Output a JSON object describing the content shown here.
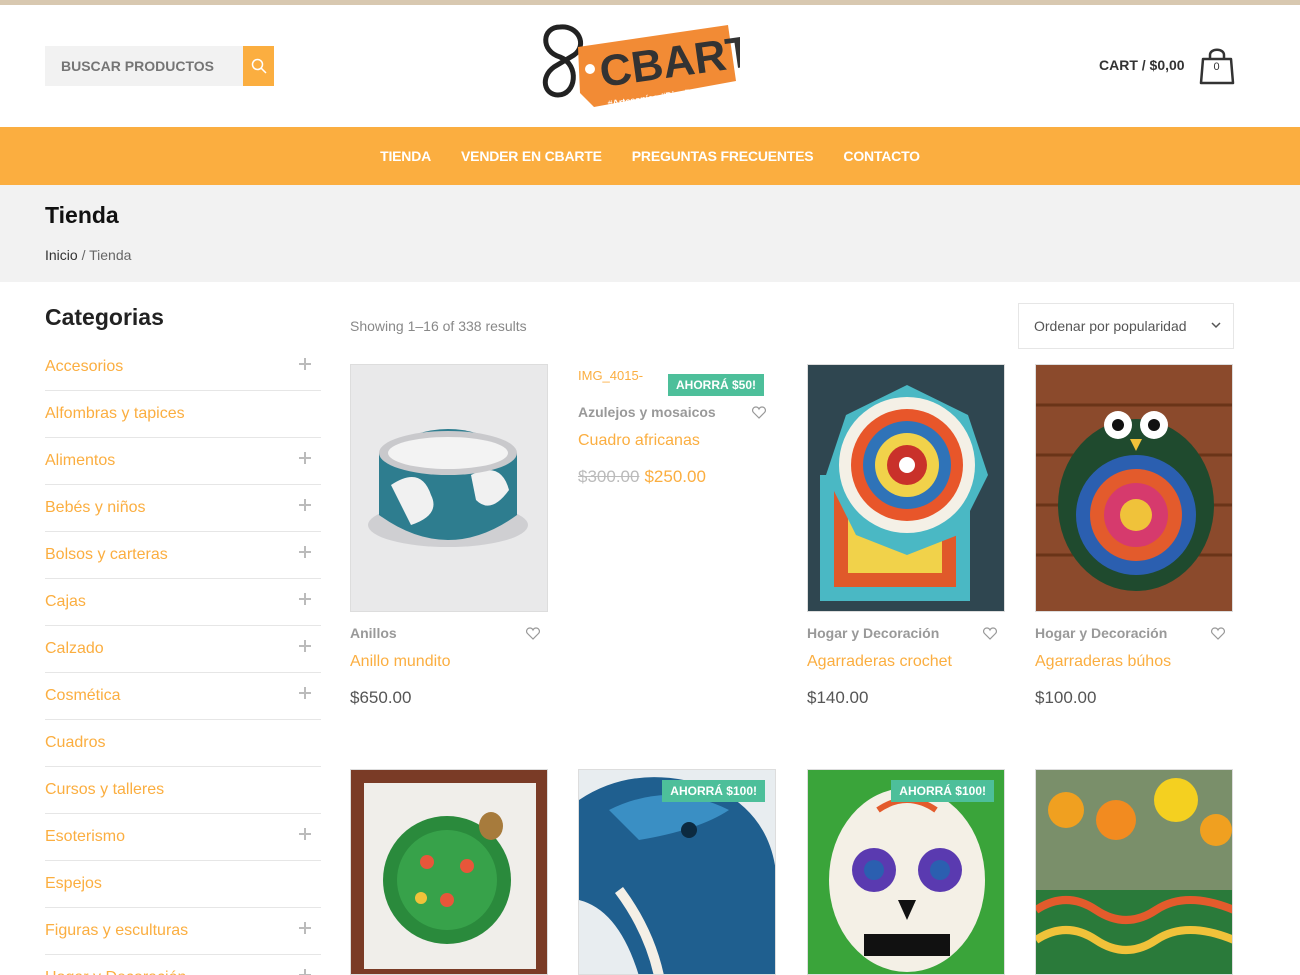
{
  "colors": {
    "accent": "#fbae40",
    "sale": "#4dbf9a",
    "title_bg": "#f2f2f2"
  },
  "header": {
    "search_placeholder": "BUSCAR PRODUCTOS",
    "logo_text": "CBARTE",
    "logo_tags": "#Artesanías #Diseño",
    "cart_label": "CART / $0,00",
    "cart_count": "0"
  },
  "nav": [
    "TIENDA",
    "VENDER EN CBARTE",
    "PREGUNTAS FRECUENTES",
    "CONTACTO"
  ],
  "page": {
    "title": "Tienda",
    "breadcrumb_home": "Inicio",
    "breadcrumb_sep": "/",
    "breadcrumb_current": "Tienda"
  },
  "sidebar": {
    "heading": "Categorias",
    "categories": [
      {
        "label": "Accesorios",
        "expandable": true
      },
      {
        "label": "Alfombras y tapices",
        "expandable": false
      },
      {
        "label": "Alimentos",
        "expandable": true
      },
      {
        "label": "Bebés y niños",
        "expandable": true
      },
      {
        "label": "Bolsos y carteras",
        "expandable": true
      },
      {
        "label": "Cajas",
        "expandable": true
      },
      {
        "label": "Calzado",
        "expandable": true
      },
      {
        "label": "Cosmética",
        "expandable": true
      },
      {
        "label": "Cuadros",
        "expandable": false
      },
      {
        "label": "Cursos y talleres",
        "expandable": false
      },
      {
        "label": "Esoterismo",
        "expandable": true
      },
      {
        "label": "Espejos",
        "expandable": false
      },
      {
        "label": "Figuras y esculturas",
        "expandable": true
      },
      {
        "label": "Hogar y Decoración",
        "expandable": true
      }
    ]
  },
  "shop": {
    "results": "Showing 1–16 of 338 results",
    "ordering": "Ordenar por popularidad"
  },
  "products": [
    {
      "category": "Anillos",
      "name": "Anillo mundito",
      "price": "$650.00"
    },
    {
      "alt": "IMG_4015-",
      "sale": "AHORRÁ $50!",
      "category": "Azulejos y mosaicos",
      "name": "Cuadro africanas",
      "old_price": "$300.00",
      "price": "$250.00"
    },
    {
      "category": "Hogar y Decoración",
      "name": "Agarraderas crochet",
      "price": "$140.00"
    },
    {
      "category": "Hogar y Decoración",
      "name": "Agarraderas búhos",
      "price": "$100.00"
    }
  ],
  "products_row2": [
    {
      "sale": ""
    },
    {
      "sale": "AHORRÁ $100!"
    },
    {
      "sale": "AHORRÁ $100!"
    },
    {
      "sale": ""
    }
  ]
}
